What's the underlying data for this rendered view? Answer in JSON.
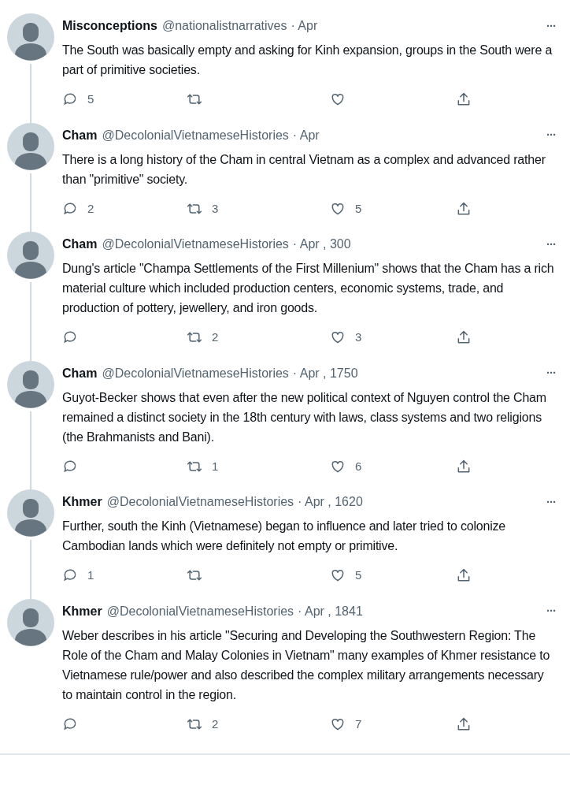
{
  "tweets": [
    {
      "name": "Misconceptions",
      "handle": "@nationalistnarratives",
      "time": "· Apr",
      "more": "···",
      "text": "The South was basically empty and asking for Kinh expansion, groups in the South were a part of primitive societies.",
      "replies": "5"
    },
    {
      "name": "Cham",
      "handle": "@DecolonialVietnameseHistories",
      "time": "· Apr",
      "more": "···",
      "text": "There is a long history of the Cham in central Vietnam as a complex and advanced rather than \"primitive\" society.",
      "replies": "2",
      "retweets": "3",
      "likes": "5"
    },
    {
      "name": "Cham",
      "handle": "@DecolonialVietnameseHistories",
      "time": "· Apr , 300",
      "more": "···",
      "text": "Dung's article \"Champa Settlements of the First Millenium\" shows that the Cham has a rich material culture which included production centers, economic systems, trade, and production of pottery, jewellery, and iron goods.",
      "retweets": "2",
      "likes": "3"
    },
    {
      "name": "Cham",
      "handle": "@DecolonialVietnameseHistories",
      "time": "· Apr , 1750",
      "more": "···",
      "text": "Guyot-Becker shows that even after the new political context of Nguyen control the Cham remained a distinct society in the 18th century with laws, class systems and two religions (the Brahmanists and Bani).",
      "retweets": "1",
      "likes": "6"
    },
    {
      "name": "Khmer",
      "handle": "@DecolonialVietnameseHistories",
      "time": "· Apr , 1620",
      "more": "···",
      "text": "Further, south the Kinh (Vietnamese) began to influence and later tried to colonize Cambodian lands which were definitely not empty or primitive.",
      "replies": "1",
      "likes": "5"
    },
    {
      "name": "Khmer",
      "handle": "@DecolonialVietnameseHistories",
      "time": "· Apr , 1841",
      "more": "···",
      "text": "Weber describes in his article \"Securing and Developing the Southwestern Region: The Role of the Cham and Malay Colonies in Vietnam\" many examples of Khmer resistance to Vietnamese rule/power and also described the complex military arrangements necessary to maintain control in the region.",
      "retweets": "2",
      "likes": "7"
    }
  ]
}
